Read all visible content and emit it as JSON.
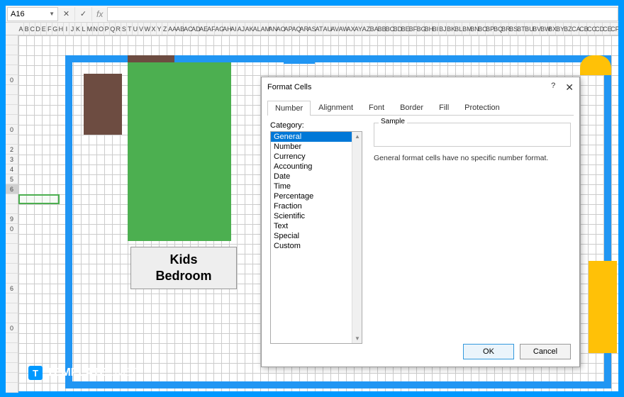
{
  "toolbar": {
    "cell_ref": "A16",
    "fx_label": "fx"
  },
  "columns": [
    "A",
    "B",
    "C",
    "D",
    "E",
    "F",
    "G",
    "H",
    "I",
    "J",
    "K",
    "L",
    "M",
    "N",
    "O",
    "P",
    "Q",
    "R",
    "S",
    "T",
    "U",
    "V",
    "W",
    "X",
    "Y",
    "Z",
    "AA",
    "AB",
    "AC",
    "AD",
    "AE",
    "AF",
    "AG",
    "AH",
    "AI",
    "AJ",
    "AK",
    "AL",
    "AM",
    "AN",
    "AO",
    "AP",
    "AQ",
    "AR",
    "AS",
    "AT",
    "AU",
    "AV",
    "AW",
    "AX",
    "AY",
    "AZ",
    "BA",
    "BB",
    "BC",
    "BD",
    "BE",
    "BF",
    "BG",
    "BH",
    "BI",
    "BJ",
    "BK",
    "BL",
    "BM",
    "BN",
    "BO",
    "BP",
    "BQ",
    "BR",
    "BS",
    "BT",
    "BU",
    "BV",
    "BW",
    "BX",
    "BY",
    "BZ",
    "CA",
    "CB",
    "CC",
    "CD",
    "CE",
    "CF"
  ],
  "rows": [
    "",
    "",
    "",
    "",
    "0",
    "",
    "",
    "",
    "",
    "0",
    "",
    "2",
    "3",
    "4",
    "5",
    "6",
    "",
    "",
    "9",
    "0",
    "",
    "",
    "",
    "",
    "",
    "6",
    "",
    "",
    "",
    "0",
    "",
    "",
    "",
    "",
    "",
    ""
  ],
  "selected_row_index": 15,
  "floorplan": {
    "room_label": "Kids\nBedroom"
  },
  "dialog": {
    "title": "Format Cells",
    "help": "?",
    "tabs": [
      "Number",
      "Alignment",
      "Font",
      "Border",
      "Fill",
      "Protection"
    ],
    "active_tab": 0,
    "category_label": "Category:",
    "categories": [
      "General",
      "Number",
      "Currency",
      "Accounting",
      "Date",
      "Time",
      "Percentage",
      "Fraction",
      "Scientific",
      "Text",
      "Special",
      "Custom"
    ],
    "selected_category": 0,
    "sample_label": "Sample",
    "description": "General format cells have no specific number format.",
    "ok": "OK",
    "cancel": "Cancel"
  },
  "watermark": {
    "badge": "T",
    "brand": "TEMPLATE",
    "suffix": ".NET"
  }
}
